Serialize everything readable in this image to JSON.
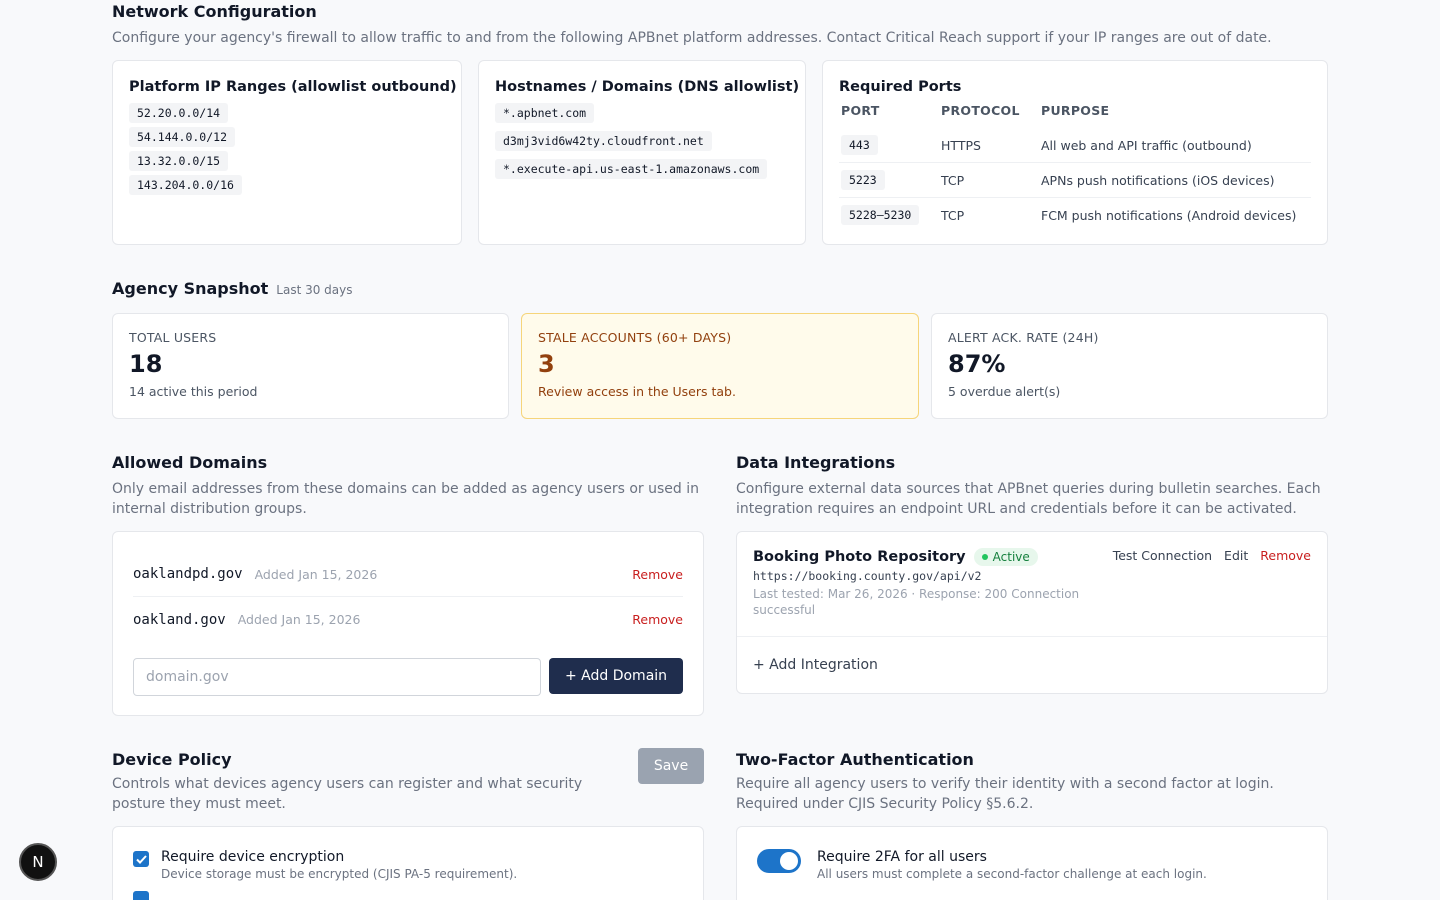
{
  "network": {
    "title": "Network Configuration",
    "description": "Configure your agency's firewall to allow traffic to and from the following APBnet platform addresses. Contact Critical Reach support if your IP ranges are out of date.",
    "ip_title": "Platform IP Ranges (allowlist outbound)",
    "ips": [
      "52.20.0.0/14",
      "54.144.0.0/12",
      "13.32.0.0/15",
      "143.204.0.0/16"
    ],
    "host_title": "Hostnames / Domains (DNS allowlist)",
    "hosts": [
      "*.apbnet.com",
      "d3mj3vid6w42ty.cloudfront.net",
      "*.execute-api.us-east-1.amazonaws.com"
    ],
    "ports_title": "Required Ports",
    "ports_headers": [
      "PORT",
      "PROTOCOL",
      "PURPOSE"
    ],
    "ports": [
      {
        "port": "443",
        "protocol": "HTTPS",
        "purpose": "All web and API traffic (outbound)"
      },
      {
        "port": "5223",
        "protocol": "TCP",
        "purpose": "APNs push notifications (iOS devices)"
      },
      {
        "port": "5228–5230",
        "protocol": "TCP",
        "purpose": "FCM push notifications (Android devices)"
      }
    ]
  },
  "snapshot": {
    "title": "Agency Snapshot",
    "subtitle": "Last 30 days",
    "total_users": {
      "label": "TOTAL USERS",
      "value": "18",
      "note": "14 active this period"
    },
    "stale": {
      "label": "STALE ACCOUNTS (60+ DAYS)",
      "value": "3",
      "note": "Review access in the Users tab."
    },
    "alert": {
      "label": "ALERT ACK. RATE (24H)",
      "value": "87%",
      "note": "5 overdue alert(s)"
    }
  },
  "domains": {
    "title": "Allowed Domains",
    "description": "Only email addresses from these domains can be added as agency users or used in internal distribution groups.",
    "items": [
      {
        "name": "oaklandpd.gov",
        "added": "Added Jan 15, 2026",
        "remove": "Remove"
      },
      {
        "name": "oakland.gov",
        "added": "Added Jan 15, 2026",
        "remove": "Remove"
      }
    ],
    "input_placeholder": "domain.gov",
    "add_label": "+ Add Domain"
  },
  "integrations": {
    "title": "Data Integrations",
    "description": "Configure external data sources that APBnet queries during bulletin searches. Each integration requires an endpoint URL and credentials before it can be activated.",
    "item": {
      "name": "Booking Photo Repository",
      "status": "Active",
      "url": "https://booking.county.gov/api/v2",
      "meta": "Last tested: Mar 26, 2026 · Response: 200 Connection successful",
      "test": "Test Connection",
      "edit": "Edit",
      "remove": "Remove"
    },
    "add_label": "+ Add Integration"
  },
  "device": {
    "title": "Device Policy",
    "description": "Controls what devices agency users can register and what security posture they must meet.",
    "save_label": "Save",
    "option1_title": "Require device encryption",
    "option1_sub": "Device storage must be encrypted (CJIS PA-5 requirement)."
  },
  "tfa": {
    "title": "Two-Factor Authentication",
    "description": "Require all agency users to verify their identity with a second factor at login. Required under CJIS Security Policy §5.6.2.",
    "option_title": "Require 2FA for all users",
    "option_sub": "All users must complete a second-factor challenge at each login."
  },
  "badge_letter": "N",
  "colors": {
    "primary": "#1f2d4d",
    "accent": "#1d74c9",
    "danger": "#c81e1e",
    "warn_bg": "#fffbeb",
    "success": "#15803d"
  }
}
